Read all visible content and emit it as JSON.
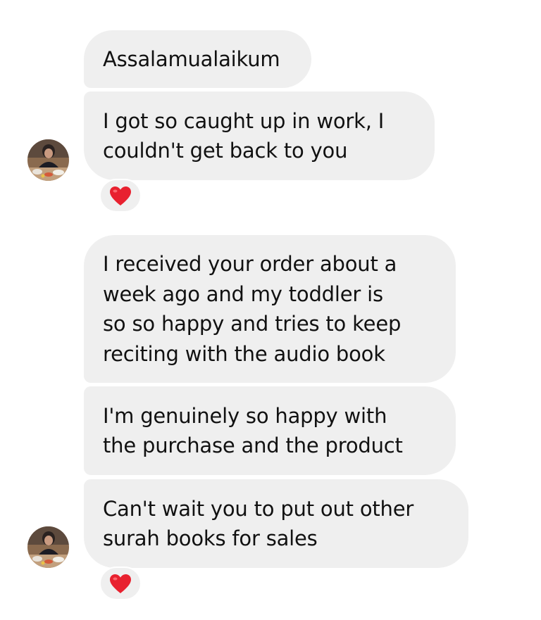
{
  "conversation": {
    "messages": [
      {
        "text": "Assalamualaikum"
      },
      {
        "text": "I got so caught up in work, I\ncouldn't get back to you"
      },
      {
        "text": "I received your order about a\nweek ago and my toddler is\nso so happy and tries to keep\nreciting with the audio book"
      },
      {
        "text": "I'm genuinely so happy with\nthe purchase and the product"
      },
      {
        "text": "Can't wait you to put out other\nsurah books for sales"
      }
    ],
    "reactions": [
      {
        "icon": "heart-icon",
        "color": "#e8212f"
      },
      {
        "icon": "heart-icon",
        "color": "#e8212f"
      }
    ],
    "bubble_color": "#efefef"
  }
}
